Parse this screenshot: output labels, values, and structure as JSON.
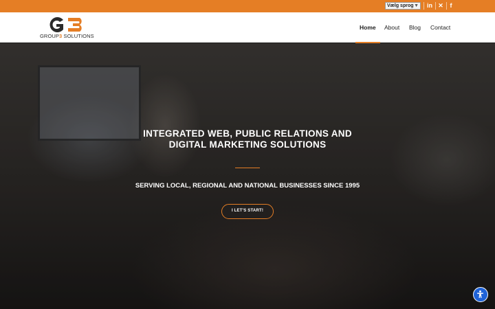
{
  "topbar": {
    "language_select": {
      "label": "Vælg sprog",
      "caret": "▼"
    },
    "social": [
      {
        "name": "linkedin",
        "glyph": "in"
      },
      {
        "name": "x-twitter",
        "glyph": "✕"
      },
      {
        "name": "facebook",
        "glyph": "f"
      }
    ]
  },
  "header": {
    "logo": {
      "part1": "GROUP",
      "part2": "3",
      "part3": " SOLUTIONS"
    },
    "nav": [
      {
        "label": "Home",
        "active": true
      },
      {
        "label": "About"
      },
      {
        "label": "Blog"
      },
      {
        "label": "Contact"
      }
    ]
  },
  "hero": {
    "title_line1": "INTEGRATED WEB, PUBLIC RELATIONS AND",
    "title_line2": "DIGITAL MARKETING SOLUTIONS",
    "subtitle": "SERVING LOCAL, REGIONAL AND NATIONAL BUSINESSES SINCE 1995",
    "cta_label": "I LET'S START!"
  },
  "colors": {
    "accent": "#e57e25",
    "accessibility": "#1f63d8"
  },
  "icons": {
    "accessibility": "accessibility-icon"
  }
}
